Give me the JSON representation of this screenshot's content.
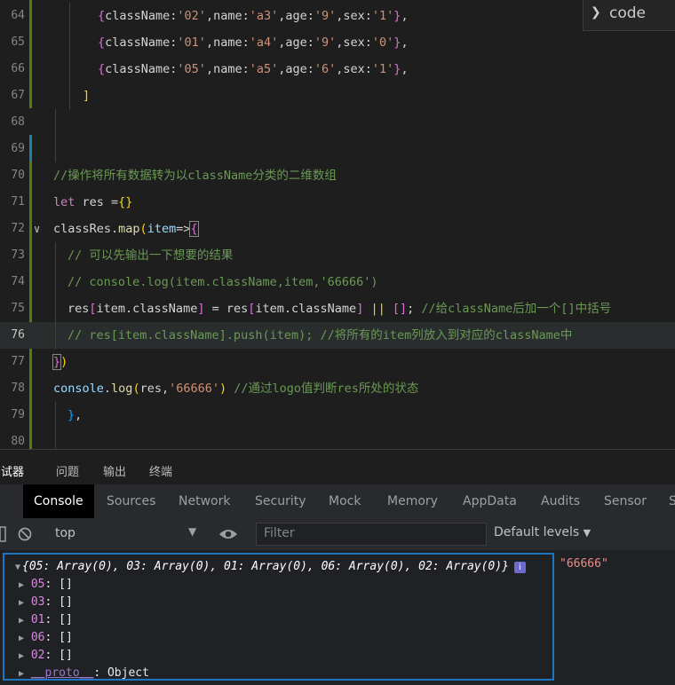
{
  "outline": {
    "label": "code"
  },
  "code_lines": [
    {
      "n": "64",
      "text": "{className:'02',name:'a3',age:'9',sex:'1'},"
    },
    {
      "n": "65",
      "text": "{className:'01',name:'a4',age:'9',sex:'0'},"
    },
    {
      "n": "66",
      "text": "{className:'05',name:'a5',age:'6',sex:'1'},"
    },
    {
      "n": "67",
      "text": "]"
    },
    {
      "n": "68",
      "text": ""
    },
    {
      "n": "69",
      "text": ""
    },
    {
      "n": "70",
      "text": "//操作将所有数据转为以className分类的二维数组"
    },
    {
      "n": "71",
      "text": "let res ={}"
    },
    {
      "n": "72",
      "text": "classRes.map(item=>{"
    },
    {
      "n": "73",
      "text": "// 可以先输出一下想要的结果"
    },
    {
      "n": "74",
      "text": "// console.log(item.className,item,'66666')"
    },
    {
      "n": "75",
      "text": "res[item.className] = res[item.className] || []; //给className后加一个[]中括号"
    },
    {
      "n": "76",
      "text": "// res[item.className].push(item); //将所有的item列放入到对应的className中"
    },
    {
      "n": "77",
      "text": "})"
    },
    {
      "n": "78",
      "text": "console.log(res,'66666') //通过logo值判断res所处的状态"
    },
    {
      "n": "79",
      "text": "},"
    },
    {
      "n": "80",
      "text": ""
    }
  ],
  "panel_tabs": [
    "调试器",
    "问题",
    "输出",
    "终端"
  ],
  "devtools_tabs": [
    "Console",
    "Sources",
    "Network",
    "Security",
    "Mock",
    "Memory",
    "AppData",
    "Audits",
    "Sensor",
    "S"
  ],
  "toolbar": {
    "context": "top",
    "filter_placeholder": "Filter",
    "levels": "Default levels"
  },
  "console": {
    "summary": "{05: Array(0), 03: Array(0), 01: Array(0), 06: Array(0), 02: Array(0)}",
    "info_badge": "i",
    "result_string": "\"66666\"",
    "properties": [
      {
        "key": "05",
        "value": "[]"
      },
      {
        "key": "03",
        "value": "[]"
      },
      {
        "key": "01",
        "value": "[]"
      },
      {
        "key": "06",
        "value": "[]"
      },
      {
        "key": "02",
        "value": "[]"
      }
    ],
    "proto": {
      "key": "__proto__",
      "value": "Object"
    }
  },
  "colors": {
    "editor_bg": "#1e1e1e",
    "highlight_box": "#1d76c2",
    "string_result": "#f28b82"
  }
}
